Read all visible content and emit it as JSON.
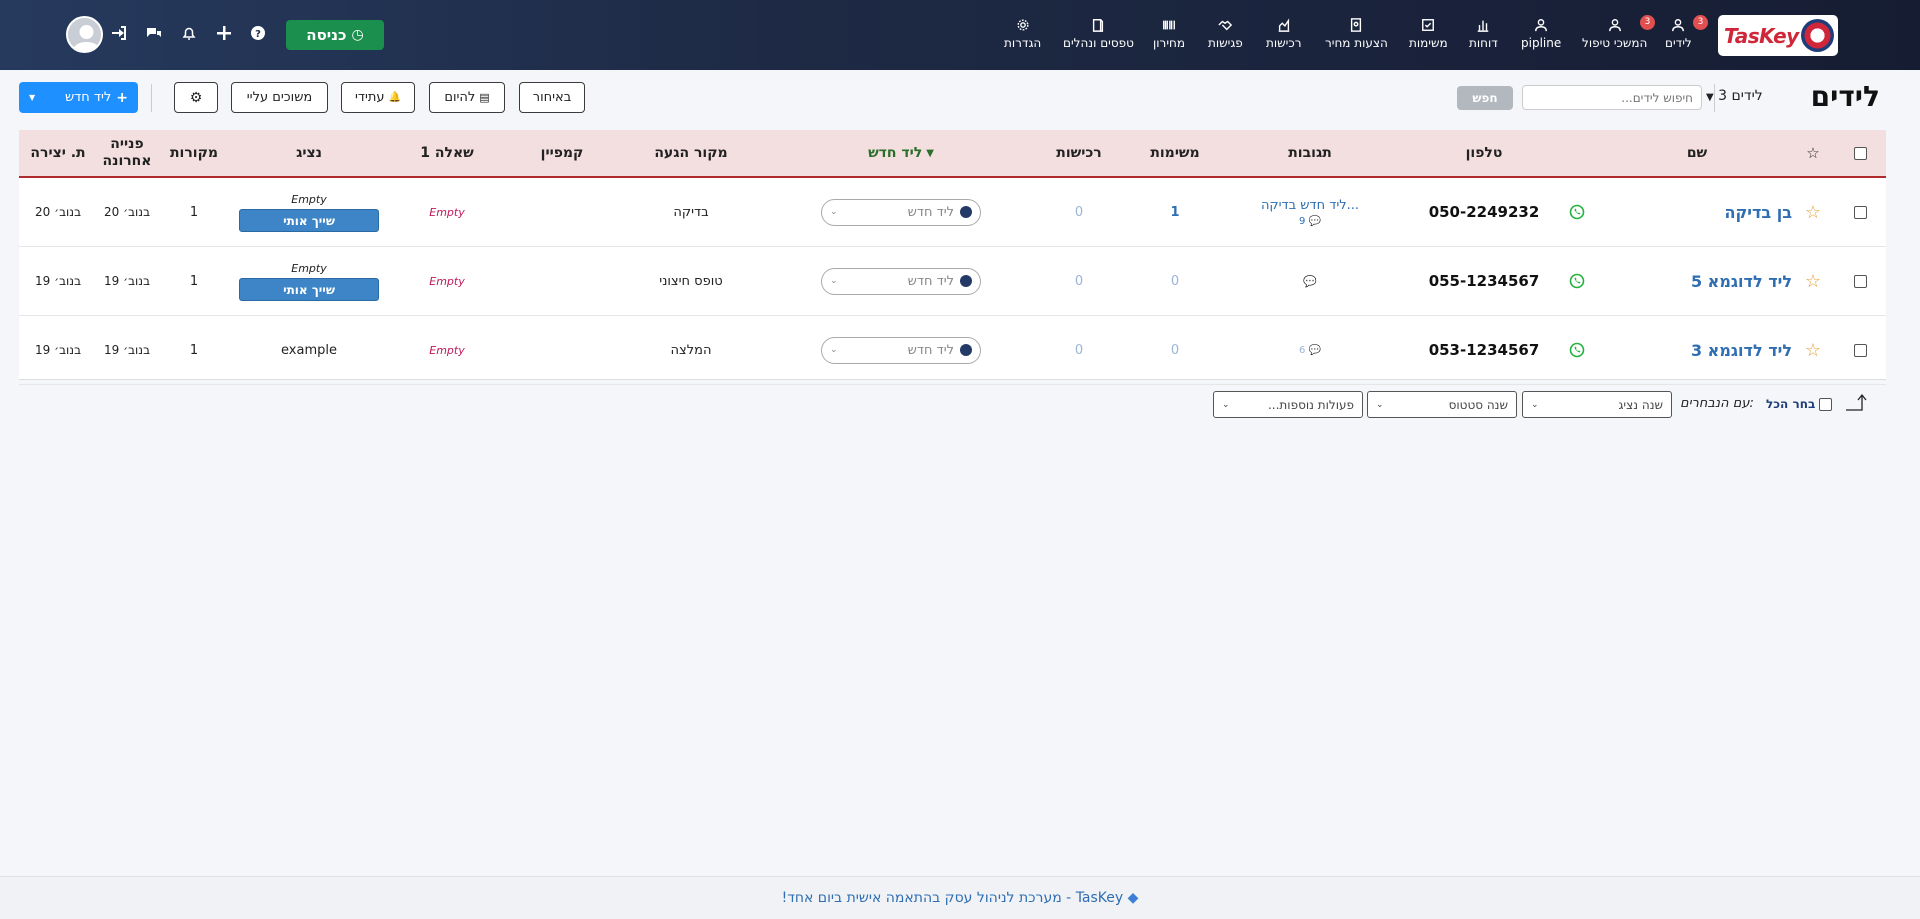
{
  "brand": {
    "logo_text": "TasKey"
  },
  "nav": {
    "items": [
      {
        "label": "לידים",
        "icon": "user-icon",
        "badge": "3"
      },
      {
        "label": "המשכי טיפול",
        "icon": "user-icon",
        "badge": "3"
      },
      {
        "label": "pipline",
        "icon": "user-icon"
      },
      {
        "label": "דוחות",
        "icon": "bar-chart-icon"
      },
      {
        "label": "משימות",
        "icon": "check-square-icon"
      },
      {
        "label": "הצעות מחיר",
        "icon": "document-icon"
      },
      {
        "label": "רכישות",
        "icon": "chart-building-icon"
      },
      {
        "label": "פגישות",
        "icon": "handshake-icon"
      },
      {
        "label": "מחירון",
        "icon": "barcode-icon"
      },
      {
        "label": "טפסים ונהלים",
        "icon": "book-icon"
      },
      {
        "label": "הגדרות",
        "icon": "gear-icon"
      }
    ],
    "enter_label": "כניסה"
  },
  "page": {
    "title": "לידים",
    "count_label": "3 לידים",
    "search_placeholder": "חיפוש לידים...",
    "search_button": "חפש",
    "filters": {
      "late": "באיחור",
      "today": "להיום",
      "future": "עתידי",
      "assigned": "משוכים עליי"
    },
    "new_lead_button": "ליד חדש"
  },
  "table": {
    "headers": {
      "name": "שם",
      "phone": "טלפון",
      "responses": "תגובות",
      "tasks": "משימות",
      "purchases": "רכישות",
      "status": "ליד חדש",
      "source": "מקור הגעה",
      "campaign": "קמפיין",
      "question1": "שאלה 1",
      "rep": "נציג",
      "sources": "מקורות",
      "last_contact": "פנייה אחרונה",
      "created": "ת. יצירה"
    },
    "rows": [
      {
        "name": "בן בדיקה",
        "phone": "050-2249232",
        "response_text": "ליד חדש בדיקה...",
        "response_count": "9",
        "tasks": "1",
        "purchases": "0",
        "status": "ליד חדש",
        "source": "בדיקה",
        "campaign": "",
        "question1": "Empty",
        "rep_top": "Empty",
        "rep_button": "שייך אותי",
        "sources": "1",
        "last_contact": "20 בנוב׳",
        "created": "20 בנוב׳"
      },
      {
        "name": "ליד לדוגמא 5",
        "phone": "055-1234567",
        "response_text": "",
        "response_count": "",
        "tasks": "0",
        "purchases": "0",
        "status": "ליד חדש",
        "source": "טופס חיצוני",
        "campaign": "",
        "question1": "Empty",
        "rep_top": "Empty",
        "rep_button": "שייך אותי",
        "sources": "1",
        "last_contact": "19 בנוב׳",
        "created": "19 בנוב׳"
      },
      {
        "name": "ליד לדוגמא 3",
        "phone": "053-1234567",
        "response_text": "",
        "response_count": "6",
        "tasks": "0",
        "purchases": "0",
        "status": "ליד חדש",
        "source": "המלצה",
        "campaign": "",
        "question1": "Empty",
        "rep_top": "example",
        "rep_button": "",
        "sources": "1",
        "last_contact": "19 בנוב׳",
        "created": "19 בנוב׳"
      }
    ]
  },
  "bulk": {
    "select_all": "בחר הכל",
    "with_selected": "עם הנבחרים:",
    "change_rep": "שנה נציג",
    "change_status": "שנה סטטוס",
    "more_actions": "פעולות נוספות..."
  },
  "footer": {
    "text": "TasKey - מערכת לניהול עסק בהתאמה אישית ביום אחד!"
  },
  "colors": {
    "accent": "#1e90ff",
    "enter": "#1b8f4e",
    "nav_bg": "#1e2a45",
    "header_bg": "#f3dfdf",
    "header_border": "#b02a2a"
  }
}
